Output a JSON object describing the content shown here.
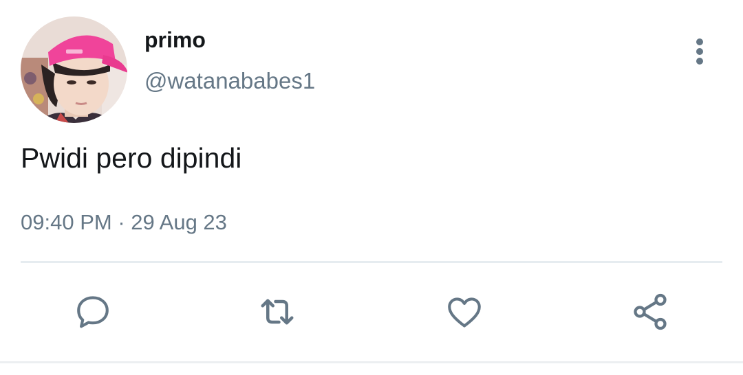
{
  "tweet": {
    "display_name": "primo",
    "handle": "@watanababes1",
    "text": "Pwidi pero dipindi",
    "time": "09:40 PM",
    "separator": "·",
    "date": "29 Aug 23"
  },
  "actions": [
    {
      "icon": "reply-icon"
    },
    {
      "icon": "retweet-icon"
    },
    {
      "icon": "like-icon"
    },
    {
      "icon": "share-icon"
    }
  ],
  "colors": {
    "text_primary": "#14171a",
    "text_secondary": "#657786",
    "divider": "#e6ecf0",
    "cap": "#f0449a"
  }
}
